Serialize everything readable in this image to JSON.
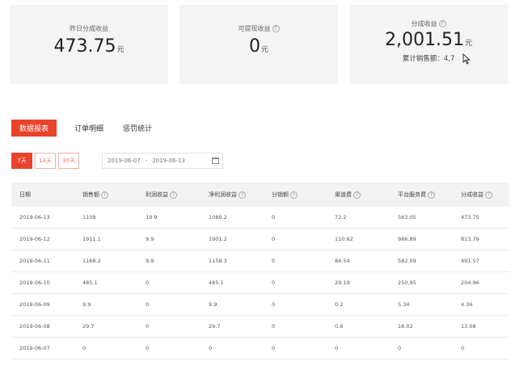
{
  "cards": {
    "yesterday": {
      "label": "昨日分成收益",
      "value": "473.75",
      "unit": "元"
    },
    "withdrawable": {
      "label": "可提现收益",
      "value": "0",
      "unit": "元"
    },
    "total": {
      "label": "分成收益",
      "value": "2,001.51",
      "unit": "元",
      "sub_label": "累计销售额：",
      "sub_value": "4,7"
    }
  },
  "tabs": [
    "数据报表",
    "订单明细",
    "惩罚统计"
  ],
  "days": [
    "7天",
    "14天",
    "30天"
  ],
  "date_range": {
    "start": "2019-06-07",
    "end": "2019-06-13"
  },
  "table": {
    "headers": [
      "日期",
      "销售额",
      "利润收益",
      "净利润收益",
      "分销额",
      "渠道费",
      "平台服务费",
      "分成收益"
    ],
    "rows": [
      [
        "2019-06-13",
        "1109",
        "19.9",
        "1089.2",
        "0",
        "72.2",
        "563.05",
        "473.75"
      ],
      [
        "2019-06-12",
        "1911.1",
        "9.9",
        "1901.2",
        "0",
        "110.62",
        "986.89",
        "813.79"
      ],
      [
        "2019-06-11",
        "1168.2",
        "9.9",
        "1158.3",
        "0",
        "84.54",
        "582.09",
        "491.57"
      ],
      [
        "2019-06-10",
        "485.1",
        "0",
        "485.1",
        "0",
        "29.19",
        "250.95",
        "204.96"
      ],
      [
        "2019-06-09",
        "9.9",
        "0",
        "9.9",
        "0",
        "0.2",
        "5.34",
        "4.36"
      ],
      [
        "2019-06-08",
        "29.7",
        "0",
        "29.7",
        "0",
        "0.6",
        "16.02",
        "13.08"
      ],
      [
        "2019-06-07",
        "0",
        "0",
        "0",
        "0",
        "0",
        "0",
        "0"
      ]
    ]
  },
  "colors": {
    "accent": "#e8432b",
    "card_bg": "#f4f4f4"
  }
}
